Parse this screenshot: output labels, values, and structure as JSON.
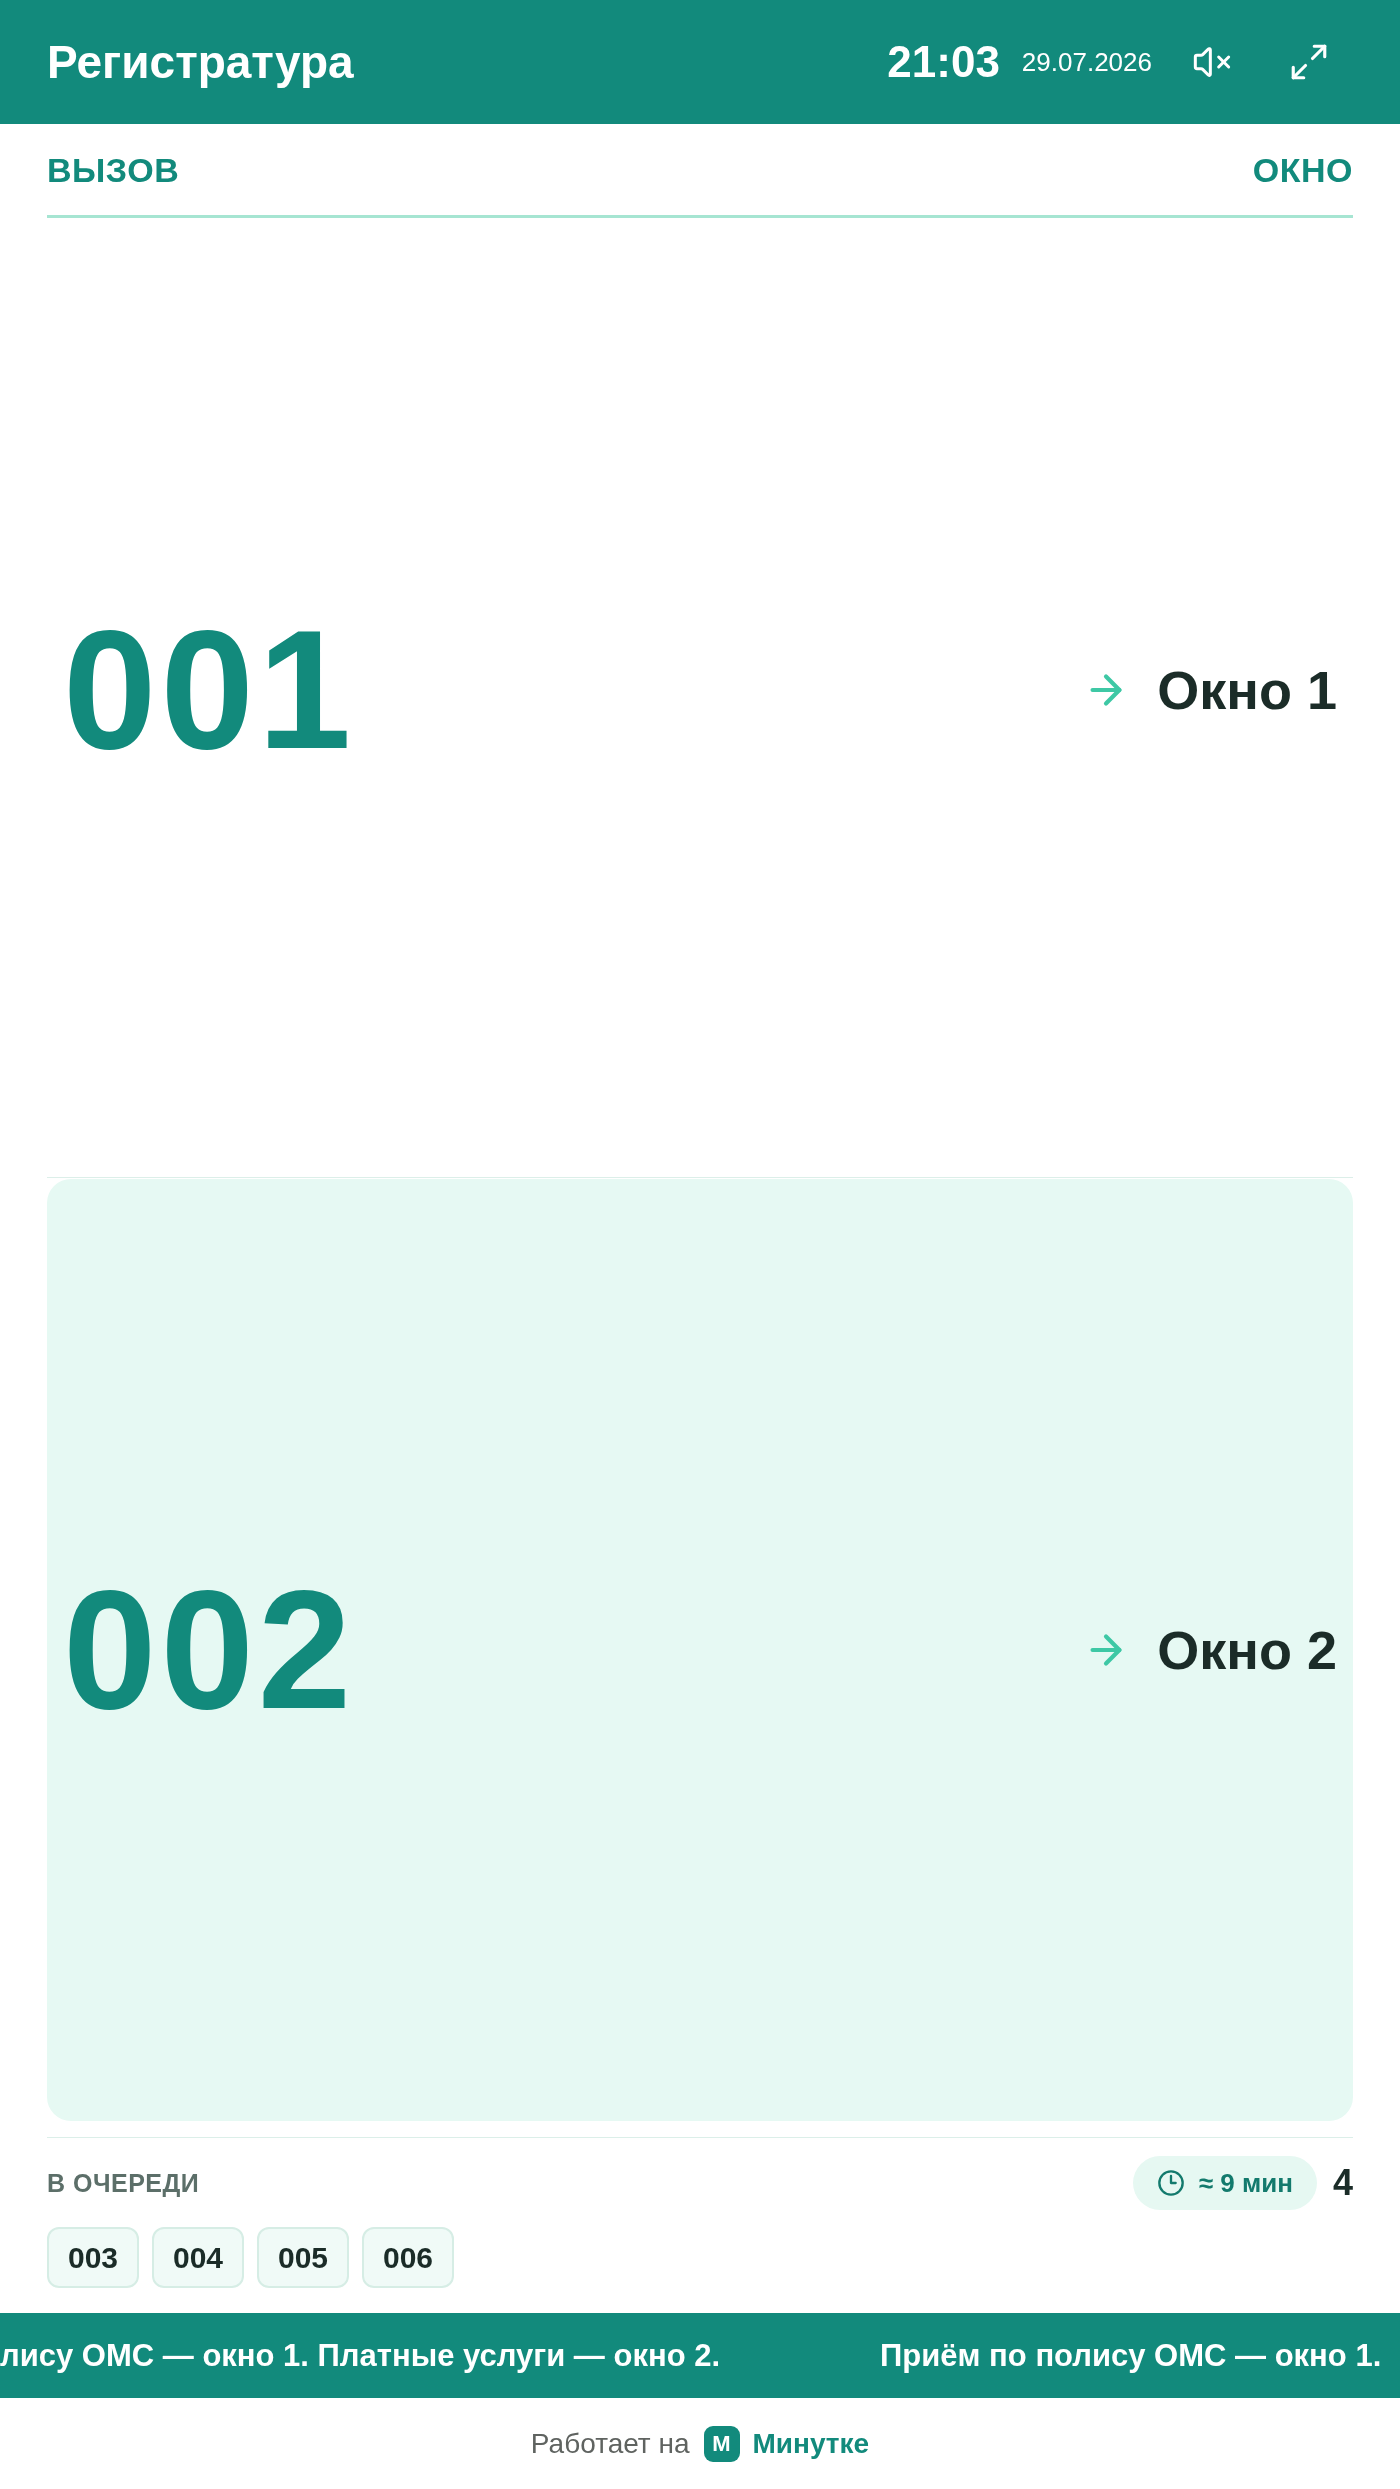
{
  "header": {
    "title": "Регистратура",
    "time": "21:03",
    "date": "29.07.2026",
    "sound_muted": true
  },
  "columns": [
    "ВЫЗОВ",
    "ОКНО"
  ],
  "calls": [
    {
      "number": "001",
      "window": "Окно 1",
      "highlighted": false
    },
    {
      "number": "002",
      "window": "Окно 2",
      "highlighted": true
    }
  ],
  "queue": {
    "label": "В ОЧЕРЕДИ",
    "wait": "≈ 9 мин",
    "count": "4",
    "tickets": [
      "003",
      "004",
      "005",
      "006"
    ]
  },
  "ticker": [
    "лису ОМС — окно 1. Платные услуги — окно 2.",
    "Приём по полису ОМС — окно 1."
  ],
  "footer": {
    "text": "Работает на",
    "logo_letter": "М",
    "brand": "Минутке"
  }
}
